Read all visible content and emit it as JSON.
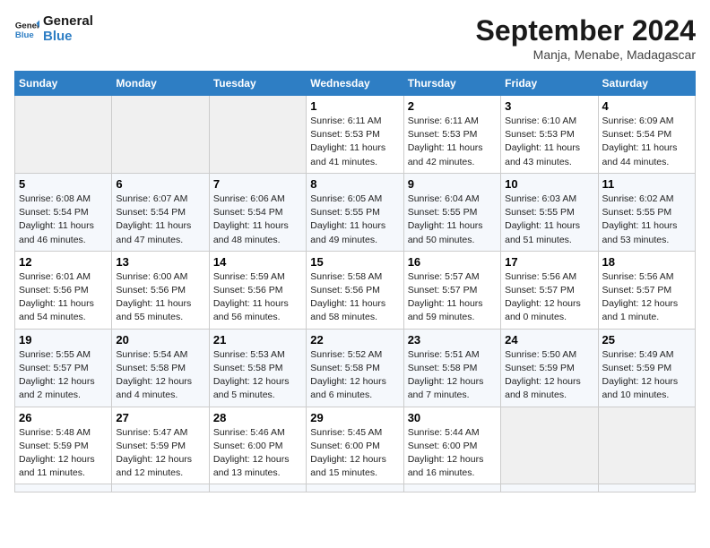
{
  "header": {
    "logo_line1": "General",
    "logo_line2": "Blue",
    "month": "September 2024",
    "location": "Manja, Menabe, Madagascar"
  },
  "weekdays": [
    "Sunday",
    "Monday",
    "Tuesday",
    "Wednesday",
    "Thursday",
    "Friday",
    "Saturday"
  ],
  "days": [
    {
      "num": "",
      "info": ""
    },
    {
      "num": "",
      "info": ""
    },
    {
      "num": "",
      "info": ""
    },
    {
      "num": "1",
      "info": "Sunrise: 6:11 AM\nSunset: 5:53 PM\nDaylight: 11 hours\nand 41 minutes."
    },
    {
      "num": "2",
      "info": "Sunrise: 6:11 AM\nSunset: 5:53 PM\nDaylight: 11 hours\nand 42 minutes."
    },
    {
      "num": "3",
      "info": "Sunrise: 6:10 AM\nSunset: 5:53 PM\nDaylight: 11 hours\nand 43 minutes."
    },
    {
      "num": "4",
      "info": "Sunrise: 6:09 AM\nSunset: 5:54 PM\nDaylight: 11 hours\nand 44 minutes."
    },
    {
      "num": "5",
      "info": "Sunrise: 6:08 AM\nSunset: 5:54 PM\nDaylight: 11 hours\nand 46 minutes."
    },
    {
      "num": "6",
      "info": "Sunrise: 6:07 AM\nSunset: 5:54 PM\nDaylight: 11 hours\nand 47 minutes."
    },
    {
      "num": "7",
      "info": "Sunrise: 6:06 AM\nSunset: 5:54 PM\nDaylight: 11 hours\nand 48 minutes."
    },
    {
      "num": "8",
      "info": "Sunrise: 6:05 AM\nSunset: 5:55 PM\nDaylight: 11 hours\nand 49 minutes."
    },
    {
      "num": "9",
      "info": "Sunrise: 6:04 AM\nSunset: 5:55 PM\nDaylight: 11 hours\nand 50 minutes."
    },
    {
      "num": "10",
      "info": "Sunrise: 6:03 AM\nSunset: 5:55 PM\nDaylight: 11 hours\nand 51 minutes."
    },
    {
      "num": "11",
      "info": "Sunrise: 6:02 AM\nSunset: 5:55 PM\nDaylight: 11 hours\nand 53 minutes."
    },
    {
      "num": "12",
      "info": "Sunrise: 6:01 AM\nSunset: 5:56 PM\nDaylight: 11 hours\nand 54 minutes."
    },
    {
      "num": "13",
      "info": "Sunrise: 6:00 AM\nSunset: 5:56 PM\nDaylight: 11 hours\nand 55 minutes."
    },
    {
      "num": "14",
      "info": "Sunrise: 5:59 AM\nSunset: 5:56 PM\nDaylight: 11 hours\nand 56 minutes."
    },
    {
      "num": "15",
      "info": "Sunrise: 5:58 AM\nSunset: 5:56 PM\nDaylight: 11 hours\nand 58 minutes."
    },
    {
      "num": "16",
      "info": "Sunrise: 5:57 AM\nSunset: 5:57 PM\nDaylight: 11 hours\nand 59 minutes."
    },
    {
      "num": "17",
      "info": "Sunrise: 5:56 AM\nSunset: 5:57 PM\nDaylight: 12 hours\nand 0 minutes."
    },
    {
      "num": "18",
      "info": "Sunrise: 5:56 AM\nSunset: 5:57 PM\nDaylight: 12 hours\nand 1 minute."
    },
    {
      "num": "19",
      "info": "Sunrise: 5:55 AM\nSunset: 5:57 PM\nDaylight: 12 hours\nand 2 minutes."
    },
    {
      "num": "20",
      "info": "Sunrise: 5:54 AM\nSunset: 5:58 PM\nDaylight: 12 hours\nand 4 minutes."
    },
    {
      "num": "21",
      "info": "Sunrise: 5:53 AM\nSunset: 5:58 PM\nDaylight: 12 hours\nand 5 minutes."
    },
    {
      "num": "22",
      "info": "Sunrise: 5:52 AM\nSunset: 5:58 PM\nDaylight: 12 hours\nand 6 minutes."
    },
    {
      "num": "23",
      "info": "Sunrise: 5:51 AM\nSunset: 5:58 PM\nDaylight: 12 hours\nand 7 minutes."
    },
    {
      "num": "24",
      "info": "Sunrise: 5:50 AM\nSunset: 5:59 PM\nDaylight: 12 hours\nand 8 minutes."
    },
    {
      "num": "25",
      "info": "Sunrise: 5:49 AM\nSunset: 5:59 PM\nDaylight: 12 hours\nand 10 minutes."
    },
    {
      "num": "26",
      "info": "Sunrise: 5:48 AM\nSunset: 5:59 PM\nDaylight: 12 hours\nand 11 minutes."
    },
    {
      "num": "27",
      "info": "Sunrise: 5:47 AM\nSunset: 5:59 PM\nDaylight: 12 hours\nand 12 minutes."
    },
    {
      "num": "28",
      "info": "Sunrise: 5:46 AM\nSunset: 6:00 PM\nDaylight: 12 hours\nand 13 minutes."
    },
    {
      "num": "29",
      "info": "Sunrise: 5:45 AM\nSunset: 6:00 PM\nDaylight: 12 hours\nand 15 minutes."
    },
    {
      "num": "30",
      "info": "Sunrise: 5:44 AM\nSunset: 6:00 PM\nDaylight: 12 hours\nand 16 minutes."
    },
    {
      "num": "",
      "info": ""
    },
    {
      "num": "",
      "info": ""
    },
    {
      "num": "",
      "info": ""
    },
    {
      "num": "",
      "info": ""
    },
    {
      "num": "",
      "info": ""
    }
  ]
}
